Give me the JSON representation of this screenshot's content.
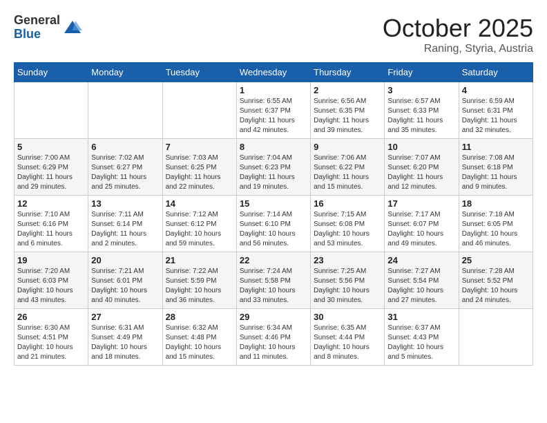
{
  "logo": {
    "general": "General",
    "blue": "Blue"
  },
  "title": {
    "month": "October 2025",
    "location": "Raning, Styria, Austria"
  },
  "weekdays": [
    "Sunday",
    "Monday",
    "Tuesday",
    "Wednesday",
    "Thursday",
    "Friday",
    "Saturday"
  ],
  "weeks": [
    [
      {
        "day": "",
        "info": ""
      },
      {
        "day": "",
        "info": ""
      },
      {
        "day": "",
        "info": ""
      },
      {
        "day": "1",
        "info": "Sunrise: 6:55 AM\nSunset: 6:37 PM\nDaylight: 11 hours\nand 42 minutes."
      },
      {
        "day": "2",
        "info": "Sunrise: 6:56 AM\nSunset: 6:35 PM\nDaylight: 11 hours\nand 39 minutes."
      },
      {
        "day": "3",
        "info": "Sunrise: 6:57 AM\nSunset: 6:33 PM\nDaylight: 11 hours\nand 35 minutes."
      },
      {
        "day": "4",
        "info": "Sunrise: 6:59 AM\nSunset: 6:31 PM\nDaylight: 11 hours\nand 32 minutes."
      }
    ],
    [
      {
        "day": "5",
        "info": "Sunrise: 7:00 AM\nSunset: 6:29 PM\nDaylight: 11 hours\nand 29 minutes."
      },
      {
        "day": "6",
        "info": "Sunrise: 7:02 AM\nSunset: 6:27 PM\nDaylight: 11 hours\nand 25 minutes."
      },
      {
        "day": "7",
        "info": "Sunrise: 7:03 AM\nSunset: 6:25 PM\nDaylight: 11 hours\nand 22 minutes."
      },
      {
        "day": "8",
        "info": "Sunrise: 7:04 AM\nSunset: 6:23 PM\nDaylight: 11 hours\nand 19 minutes."
      },
      {
        "day": "9",
        "info": "Sunrise: 7:06 AM\nSunset: 6:22 PM\nDaylight: 11 hours\nand 15 minutes."
      },
      {
        "day": "10",
        "info": "Sunrise: 7:07 AM\nSunset: 6:20 PM\nDaylight: 11 hours\nand 12 minutes."
      },
      {
        "day": "11",
        "info": "Sunrise: 7:08 AM\nSunset: 6:18 PM\nDaylight: 11 hours\nand 9 minutes."
      }
    ],
    [
      {
        "day": "12",
        "info": "Sunrise: 7:10 AM\nSunset: 6:16 PM\nDaylight: 11 hours\nand 6 minutes."
      },
      {
        "day": "13",
        "info": "Sunrise: 7:11 AM\nSunset: 6:14 PM\nDaylight: 11 hours\nand 2 minutes."
      },
      {
        "day": "14",
        "info": "Sunrise: 7:12 AM\nSunset: 6:12 PM\nDaylight: 10 hours\nand 59 minutes."
      },
      {
        "day": "15",
        "info": "Sunrise: 7:14 AM\nSunset: 6:10 PM\nDaylight: 10 hours\nand 56 minutes."
      },
      {
        "day": "16",
        "info": "Sunrise: 7:15 AM\nSunset: 6:08 PM\nDaylight: 10 hours\nand 53 minutes."
      },
      {
        "day": "17",
        "info": "Sunrise: 7:17 AM\nSunset: 6:07 PM\nDaylight: 10 hours\nand 49 minutes."
      },
      {
        "day": "18",
        "info": "Sunrise: 7:18 AM\nSunset: 6:05 PM\nDaylight: 10 hours\nand 46 minutes."
      }
    ],
    [
      {
        "day": "19",
        "info": "Sunrise: 7:20 AM\nSunset: 6:03 PM\nDaylight: 10 hours\nand 43 minutes."
      },
      {
        "day": "20",
        "info": "Sunrise: 7:21 AM\nSunset: 6:01 PM\nDaylight: 10 hours\nand 40 minutes."
      },
      {
        "day": "21",
        "info": "Sunrise: 7:22 AM\nSunset: 5:59 PM\nDaylight: 10 hours\nand 36 minutes."
      },
      {
        "day": "22",
        "info": "Sunrise: 7:24 AM\nSunset: 5:58 PM\nDaylight: 10 hours\nand 33 minutes."
      },
      {
        "day": "23",
        "info": "Sunrise: 7:25 AM\nSunset: 5:56 PM\nDaylight: 10 hours\nand 30 minutes."
      },
      {
        "day": "24",
        "info": "Sunrise: 7:27 AM\nSunset: 5:54 PM\nDaylight: 10 hours\nand 27 minutes."
      },
      {
        "day": "25",
        "info": "Sunrise: 7:28 AM\nSunset: 5:52 PM\nDaylight: 10 hours\nand 24 minutes."
      }
    ],
    [
      {
        "day": "26",
        "info": "Sunrise: 6:30 AM\nSunset: 4:51 PM\nDaylight: 10 hours\nand 21 minutes."
      },
      {
        "day": "27",
        "info": "Sunrise: 6:31 AM\nSunset: 4:49 PM\nDaylight: 10 hours\nand 18 minutes."
      },
      {
        "day": "28",
        "info": "Sunrise: 6:32 AM\nSunset: 4:48 PM\nDaylight: 10 hours\nand 15 minutes."
      },
      {
        "day": "29",
        "info": "Sunrise: 6:34 AM\nSunset: 4:46 PM\nDaylight: 10 hours\nand 11 minutes."
      },
      {
        "day": "30",
        "info": "Sunrise: 6:35 AM\nSunset: 4:44 PM\nDaylight: 10 hours\nand 8 minutes."
      },
      {
        "day": "31",
        "info": "Sunrise: 6:37 AM\nSunset: 4:43 PM\nDaylight: 10 hours\nand 5 minutes."
      },
      {
        "day": "",
        "info": ""
      }
    ]
  ]
}
